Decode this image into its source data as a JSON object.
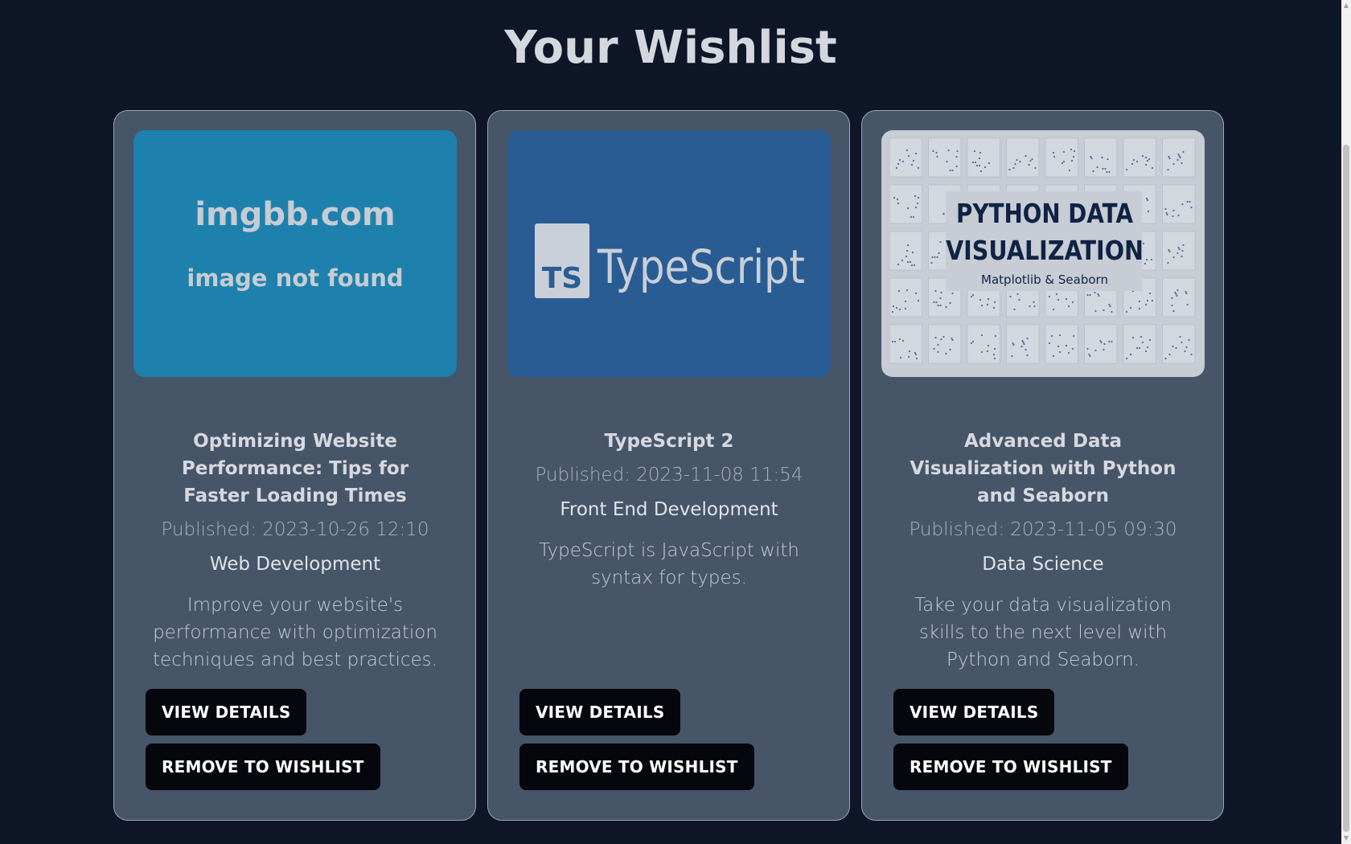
{
  "page": {
    "title": "Your Wishlist"
  },
  "cards": [
    {
      "image_text_line1": "imgbb.com",
      "image_text_line2": "image not found",
      "title": "Optimizing Website Performance: Tips for Faster Loading Times",
      "published": "Published: 2023-10-26 12:10",
      "category": "Web Development",
      "description": "Improve your website's performance with optimization techniques and best practices.",
      "view_label": "VIEW DETAILS",
      "remove_label": "REMOVE TO WISHLIST"
    },
    {
      "image_logo_text": "TS",
      "image_text": "TypeScript",
      "title": "TypeScript 2",
      "published": "Published: 2023-11-08 11:54",
      "category": "Front End Development",
      "description": "TypeScript is JavaScript with syntax for types.",
      "view_label": "VIEW DETAILS",
      "remove_label": "REMOVE TO WISHLIST"
    },
    {
      "image_heading_line1": "PYTHON DATA",
      "image_heading_line2": "VISUALIZATION",
      "image_subheading": "Matplotlib & Seaborn",
      "title": "Advanced Data Visualization with Python and Seaborn",
      "published": "Published: 2023-11-05 09:30",
      "category": "Data Science",
      "description": "Take your data visualization skills to the next level with Python and Seaborn.",
      "view_label": "VIEW DETAILS",
      "remove_label": "REMOVE TO WISHLIST"
    }
  ],
  "colors": {
    "background": "#0f1628",
    "card": "#475569",
    "button": "#05070d",
    "imgbb_blue": "#1e81ad",
    "typescript_blue": "#2a5c94"
  }
}
